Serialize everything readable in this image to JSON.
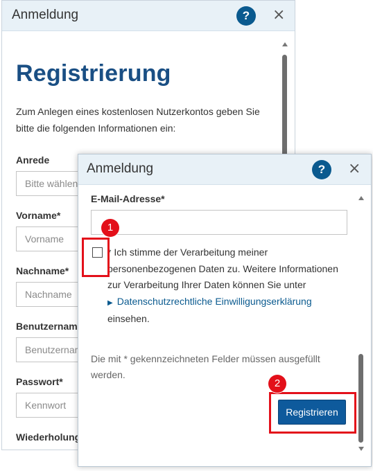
{
  "back_dialog": {
    "title": "Anmeldung",
    "help": "?",
    "close": "×",
    "heading": "Registrierung",
    "intro": "Zum Anlegen eines kostenlosen Nutzerkontos geben Sie bitte die folgenden Informationen ein:",
    "fields": [
      {
        "label": "Anrede",
        "value": "Bitte wählen"
      },
      {
        "label": "Vorname*",
        "placeholder": "Vorname"
      },
      {
        "label": "Nachname*",
        "placeholder": "Nachname"
      },
      {
        "label": "Benutzername",
        "placeholder": "Benutzername"
      },
      {
        "label": "Passwort*",
        "placeholder": "Kennwort"
      },
      {
        "label": "Wiederholung"
      }
    ]
  },
  "front_dialog": {
    "title": "Anmeldung",
    "help": "?",
    "close": "×",
    "email_label": "E-Mail-Adresse*",
    "consent_text": "* Ich stimme der Verarbeitung meiner personenbezogenen Daten zu. Weitere Informationen zur Verarbeitung Ihrer Daten können Sie unter",
    "consent_link": "Datenschutzrechtliche Einwilligungserklärung",
    "consent_tail": "einsehen.",
    "required_note": "Die mit * gekennzeichneten Felder müssen ausgefüllt werden.",
    "register_button": "Registrieren"
  },
  "annotations": {
    "badge_1": "1",
    "badge_2": "2",
    "color": "#e3101a"
  },
  "icons": {
    "help": "question-circle-icon",
    "close": "close-icon",
    "link_chevron": "chevron-right-icon"
  }
}
